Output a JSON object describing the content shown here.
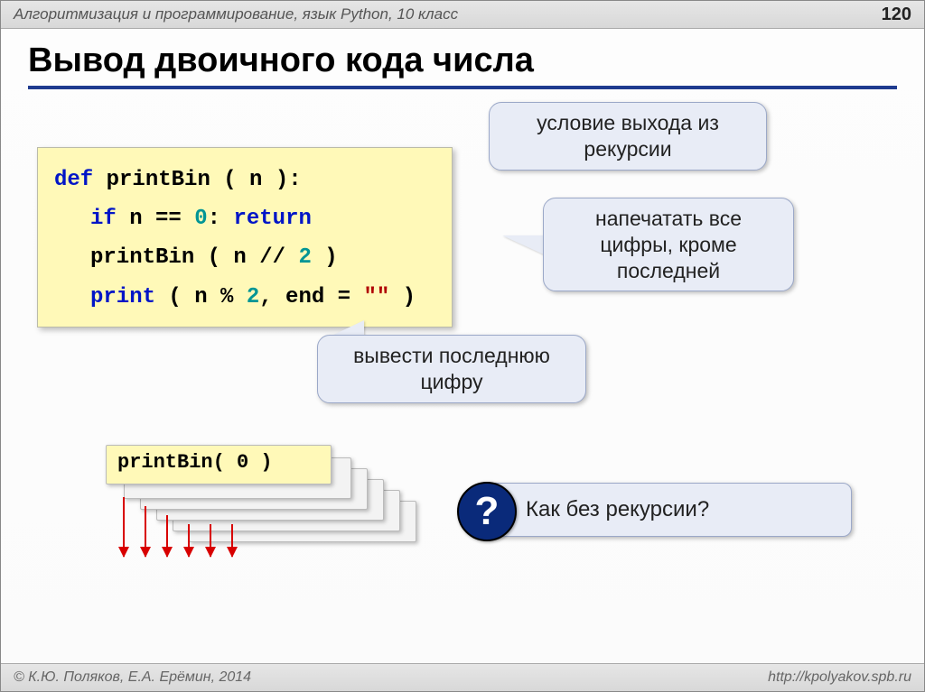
{
  "header": {
    "subject": "Алгоритмизация и программирование, язык Python, 10 класс",
    "page": "120"
  },
  "title": "Вывод двоичного кода числа",
  "code": {
    "l1a": "def",
    "l1b": " printBin ( n ):",
    "l2a": "if",
    "l2b": " n == ",
    "l2c": "0",
    "l2d": ": ",
    "l2e": "return",
    "l3a": "printBin ( n // ",
    "l3b": "2",
    "l3c": " )",
    "l4a": "print",
    "l4b": " ( n % ",
    "l4c": "2",
    "l4d": ", end = ",
    "l4e": "\"\"",
    "l4f": " )"
  },
  "callouts": {
    "c1": "условие выхода из рекурсии",
    "c2": "напечатать все цифры, кроме последней",
    "c3": "вывести последнюю цифру"
  },
  "stackcall": {
    "fn": "printBin",
    "args": "( 0 )"
  },
  "question": {
    "mark": "?",
    "text": "Как без рекурсии?"
  },
  "footer": {
    "copyright": "© К.Ю. Поляков, Е.А. Ерёмин, 2014",
    "link": "http://kpolyakov.spb.ru"
  }
}
